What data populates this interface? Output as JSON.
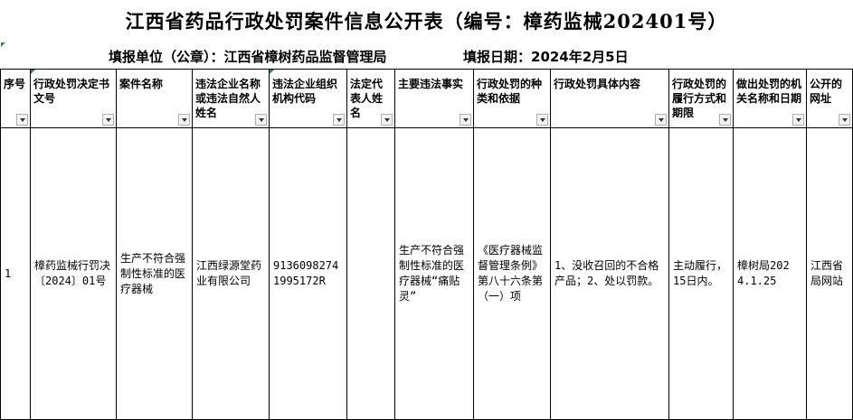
{
  "title": "江西省药品行政处罚案件信息公开表（编号：樟药监械202401号）",
  "report_unit": "填报单位（公章）：江西省樟树药品监督管理局",
  "report_date": "填报日期：2024年2月5日",
  "headers": [
    "序号",
    "行政处罚决定书文号",
    "案件名称",
    "违法企业名称或违法自然人姓名",
    "违法企业组织机构代码",
    "法定代表人姓名",
    "主要违法事实",
    "行政处罚的种类和依据",
    "行政处罚具体内容",
    "行政处罚的履行方式和期限",
    "做出处罚的机关名称和日期",
    "公开的网址"
  ],
  "row": [
    "1",
    "樟药监械行罚决〔2024〕01号",
    "生产不符合强制性标准的医疗器械",
    "江西绿源堂药业有限公司",
    "91360982741995172R",
    "",
    "生产不符合强制性标准的医疗器械“痛贴灵”",
    "《医疗器械监督管理条例》第八十六条第（一）项",
    "1、没收召回的不合格产品；2、处以罚款。",
    "主动履行，15日内。",
    "樟树局2024.1.25",
    "江西省局网站"
  ]
}
